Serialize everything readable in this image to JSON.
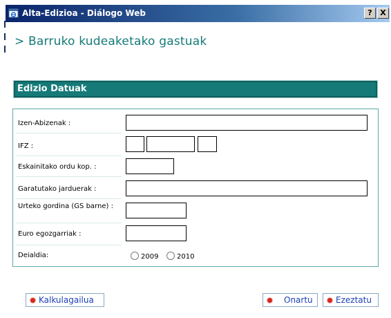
{
  "window": {
    "title": "Alta-Edizioa - Diálogo Web",
    "help_button": "?",
    "close_button": "X"
  },
  "page": {
    "title": "> Barruko kudeaketako gastuak"
  },
  "section": {
    "title": "Edizio Datuak"
  },
  "form": {
    "name_label": "Izen-Abizenak :",
    "name_value": "",
    "ifz_label": "IFZ :",
    "ifz_values": [
      "",
      "",
      ""
    ],
    "hours_label": "Eskainitako ordu kop. :",
    "hours_value": "",
    "activities_label": "Garatutako jarduerak :",
    "activities_value": "",
    "annual_label": "Urteko gordina (GS barne) :",
    "annual_value": "",
    "euro_label": "Euro egozgarriak :",
    "euro_value": "",
    "call_label": "Deialdia:",
    "call_options": [
      "2009",
      "2010"
    ],
    "call_selected": ""
  },
  "buttons": {
    "calculator": "Kalkulagailua",
    "accept": "Onartu",
    "cancel": "Ezeztatu"
  },
  "colors": {
    "accent": "#157a78",
    "titlebar": "#0a246a",
    "button_text": "#1a3fb5",
    "bullet": "#d6281f"
  }
}
